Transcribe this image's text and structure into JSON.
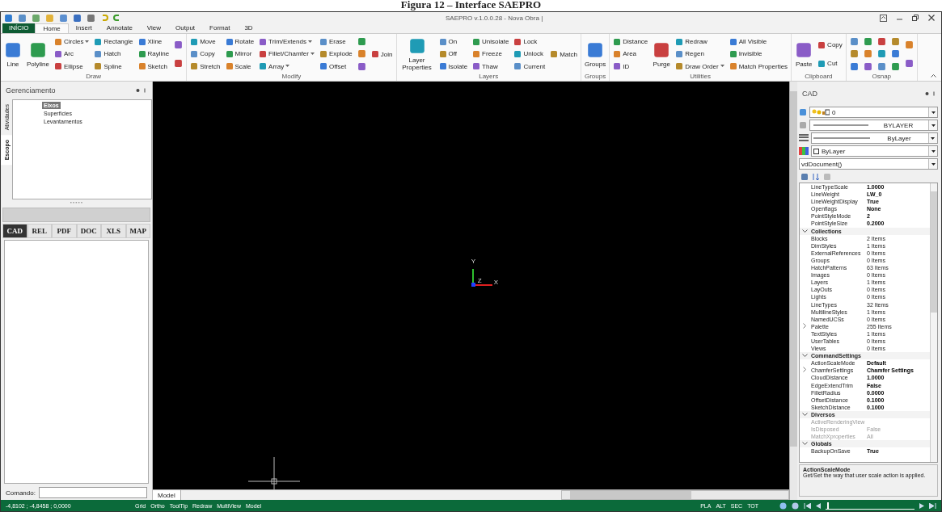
{
  "caption": "Figura 12 – Interface SAEPRO",
  "window": {
    "title": "SAEPRO v.1.0.0.28 - Nova Obra |"
  },
  "ribbon_tabs": [
    {
      "label": "INÍCIO",
      "kind": "app",
      "selected": false
    },
    {
      "label": "Home",
      "kind": "tab",
      "selected": true
    },
    {
      "label": "Insert",
      "kind": "tab",
      "selected": false
    },
    {
      "label": "Annotate",
      "kind": "tab",
      "selected": false
    },
    {
      "label": "View",
      "kind": "tab",
      "selected": false
    },
    {
      "label": "Output",
      "kind": "tab",
      "selected": false
    },
    {
      "label": "Format",
      "kind": "tab",
      "selected": false
    },
    {
      "label": "3D",
      "kind": "tab",
      "selected": false
    }
  ],
  "ribbon": {
    "groups": [
      {
        "label": "Draw",
        "columns": [
          {
            "kind": "large",
            "label": "Line"
          },
          {
            "kind": "large",
            "label": "Polyline"
          },
          {
            "kind": "small",
            "items": [
              {
                "label": "Circles",
                "dropdown": true
              },
              {
                "label": "Arc",
                "dropdown": false
              },
              {
                "label": "Ellipse",
                "dropdown": false
              }
            ]
          },
          {
            "kind": "small",
            "items": [
              {
                "label": "Rectangle",
                "dropdown": false
              },
              {
                "label": "Hatch",
                "dropdown": false
              },
              {
                "label": "Spline",
                "dropdown": false
              }
            ]
          },
          {
            "kind": "small",
            "items": [
              {
                "label": "Xline",
                "dropdown": false
              },
              {
                "label": "Rayline",
                "dropdown": false
              },
              {
                "label": "Sketch",
                "dropdown": false
              }
            ]
          },
          {
            "kind": "icon_pair"
          }
        ]
      },
      {
        "label": "Modify",
        "columns": [
          {
            "kind": "small",
            "items": [
              {
                "label": "Move",
                "dropdown": false
              },
              {
                "label": "Copy",
                "dropdown": false
              },
              {
                "label": "Stretch",
                "dropdown": false
              }
            ]
          },
          {
            "kind": "small",
            "items": [
              {
                "label": "Rotate",
                "dropdown": false
              },
              {
                "label": "Mirror",
                "dropdown": false
              },
              {
                "label": "Scale",
                "dropdown": false
              }
            ]
          },
          {
            "kind": "small",
            "items": [
              {
                "label": "Trim/Extends",
                "dropdown": true
              },
              {
                "label": "Fillet/Chamfer",
                "dropdown": true
              },
              {
                "label": "Array",
                "dropdown": true
              }
            ]
          },
          {
            "kind": "small",
            "items": [
              {
                "label": "Erase",
                "dropdown": false
              },
              {
                "label": "Explode",
                "dropdown": false
              },
              {
                "label": "Offset",
                "dropdown": false
              }
            ]
          },
          {
            "kind": "icon_triple"
          },
          {
            "kind": "small",
            "items": [
              {
                "label": "Join",
                "dropdown": false
              }
            ]
          }
        ]
      },
      {
        "label": "Layers",
        "columns": [
          {
            "kind": "large",
            "label": "Layer Properties"
          },
          {
            "kind": "small",
            "items": [
              {
                "label": "On",
                "dropdown": false
              },
              {
                "label": "Off",
                "dropdown": false
              },
              {
                "label": "Isolate",
                "dropdown": false
              }
            ]
          },
          {
            "kind": "small",
            "items": [
              {
                "label": "Unisolate",
                "dropdown": false
              },
              {
                "label": "Freeze",
                "dropdown": false
              },
              {
                "label": "Thaw",
                "dropdown": false
              }
            ]
          },
          {
            "kind": "small",
            "items": [
              {
                "label": "Lock",
                "dropdown": false
              },
              {
                "label": "Unlock",
                "dropdown": false
              },
              {
                "label": "Current",
                "dropdown": false
              }
            ]
          },
          {
            "kind": "small",
            "items": [
              {
                "label": "Match",
                "dropdown": false
              }
            ]
          }
        ]
      },
      {
        "label": "Groups",
        "columns": [
          {
            "kind": "large",
            "label": "Groups"
          }
        ]
      },
      {
        "label": "Utilities",
        "columns": [
          {
            "kind": "small",
            "items": [
              {
                "label": "Distance",
                "dropdown": false
              },
              {
                "label": "Area",
                "dropdown": false
              },
              {
                "label": "ID",
                "dropdown": false
              }
            ]
          },
          {
            "kind": "large",
            "label": "Purge"
          },
          {
            "kind": "small",
            "items": [
              {
                "label": "Redraw",
                "dropdown": false
              },
              {
                "label": "Regen",
                "dropdown": false
              },
              {
                "label": "Draw Order",
                "dropdown": true
              }
            ]
          },
          {
            "kind": "small",
            "items": [
              {
                "label": "All Visible",
                "dropdown": false
              },
              {
                "label": "Invisible",
                "dropdown": false
              },
              {
                "label": "Match Properties",
                "dropdown": false
              }
            ]
          }
        ]
      },
      {
        "label": "Clipboard",
        "columns": [
          {
            "kind": "large",
            "label": "Paste"
          },
          {
            "kind": "small",
            "items": [
              {
                "label": "Copy",
                "dropdown": false
              },
              {
                "label": "Cut",
                "dropdown": false
              }
            ]
          }
        ]
      },
      {
        "label": "Osnap",
        "columns": [
          {
            "kind": "icon_triple"
          },
          {
            "kind": "icon_triple"
          },
          {
            "kind": "icon_triple"
          },
          {
            "kind": "icon_triple"
          },
          {
            "kind": "icon_pair"
          }
        ]
      }
    ]
  },
  "left_panel": {
    "title": "Gerenciamento",
    "side_tabs": [
      {
        "label": "Atividades",
        "selected": false
      },
      {
        "label": "Escopo",
        "selected": true
      }
    ],
    "tree": [
      {
        "label": "Eixos",
        "selected": true
      },
      {
        "label": "Superfícies",
        "selected": false
      },
      {
        "label": "Levantamentos",
        "selected": false
      }
    ],
    "doc_tabs": [
      {
        "label": "CAD",
        "selected": true
      },
      {
        "label": "REL",
        "selected": false
      },
      {
        "label": "PDF",
        "selected": false
      },
      {
        "label": "DOC",
        "selected": false
      },
      {
        "label": "XLS",
        "selected": false
      },
      {
        "label": "MAP",
        "selected": false
      }
    ],
    "command": {
      "label": "Comando:"
    }
  },
  "canvas": {
    "axes": {
      "y": "Y",
      "z": "Z",
      "x": "X"
    },
    "layout_tabs": [
      {
        "label": "Model",
        "selected": true
      }
    ]
  },
  "right_panel": {
    "title": "CAD",
    "layer": "0",
    "linetype": "BYLAYER",
    "lineweight": "ByLayer",
    "color_setting": "ByLayer",
    "object": "vdDocument()",
    "properties": [
      {
        "kind": "property",
        "name": "LineTypeScale",
        "value": "1.0000",
        "modified": true,
        "disabled": false,
        "expandable": false
      },
      {
        "kind": "property",
        "name": "LineWeight",
        "value": "LW_0",
        "modified": true,
        "disabled": false,
        "expandable": false
      },
      {
        "kind": "property",
        "name": "LineWeightDisplay",
        "value": "True",
        "modified": true,
        "disabled": false,
        "expandable": false
      },
      {
        "kind": "property",
        "name": "Openflags",
        "value": "None",
        "modified": true,
        "disabled": false,
        "expandable": false
      },
      {
        "kind": "property",
        "name": "PointStyleMode",
        "value": "2",
        "modified": true,
        "disabled": false,
        "expandable": false
      },
      {
        "kind": "property",
        "name": "PointStyleSize",
        "value": "0.2000",
        "modified": true,
        "disabled": false,
        "expandable": false
      },
      {
        "kind": "category",
        "name": "Collections",
        "expanded": true
      },
      {
        "kind": "property",
        "name": "Blocks",
        "value": "2 Items",
        "modified": false,
        "disabled": false,
        "expandable": false
      },
      {
        "kind": "property",
        "name": "DimStyles",
        "value": "1 Items",
        "modified": false,
        "disabled": false,
        "expandable": false
      },
      {
        "kind": "property",
        "name": "ExternalReferences",
        "value": "0 Items",
        "modified": false,
        "disabled": false,
        "expandable": false
      },
      {
        "kind": "property",
        "name": "Groups",
        "value": "0 Items",
        "modified": false,
        "disabled": false,
        "expandable": false
      },
      {
        "kind": "property",
        "name": "HatchPatterns",
        "value": "63 Items",
        "modified": false,
        "disabled": false,
        "expandable": false
      },
      {
        "kind": "property",
        "name": "Images",
        "value": "0 Items",
        "modified": false,
        "disabled": false,
        "expandable": false
      },
      {
        "kind": "property",
        "name": "Layers",
        "value": "1 Items",
        "modified": false,
        "disabled": false,
        "expandable": false
      },
      {
        "kind": "property",
        "name": "LayOuts",
        "value": "0 Items",
        "modified": false,
        "disabled": false,
        "expandable": false
      },
      {
        "kind": "property",
        "name": "Lights",
        "value": "0 Items",
        "modified": false,
        "disabled": false,
        "expandable": false
      },
      {
        "kind": "property",
        "name": "LineTypes",
        "value": "32 Items",
        "modified": false,
        "disabled": false,
        "expandable": false
      },
      {
        "kind": "property",
        "name": "MultilineStyles",
        "value": "1 Items",
        "modified": false,
        "disabled": false,
        "expandable": false
      },
      {
        "kind": "property",
        "name": "NamedUCSs",
        "value": "0 Items",
        "modified": false,
        "disabled": false,
        "expandable": false
      },
      {
        "kind": "property",
        "name": "Palette",
        "value": "255 Items",
        "modified": false,
        "disabled": false,
        "expandable": true
      },
      {
        "kind": "property",
        "name": "TextStyles",
        "value": "1 Items",
        "modified": false,
        "disabled": false,
        "expandable": false
      },
      {
        "kind": "property",
        "name": "UserTables",
        "value": "0 Items",
        "modified": false,
        "disabled": false,
        "expandable": false
      },
      {
        "kind": "property",
        "name": "Views",
        "value": "0 Items",
        "modified": false,
        "disabled": false,
        "expandable": false
      },
      {
        "kind": "category",
        "name": "CommandSettings",
        "expanded": true
      },
      {
        "kind": "property",
        "name": "ActionScaleMode",
        "value": "Default",
        "modified": true,
        "disabled": false,
        "expandable": false
      },
      {
        "kind": "property",
        "name": "ChamferSettings",
        "value": "Chamfer Settings",
        "modified": true,
        "disabled": false,
        "expandable": true
      },
      {
        "kind": "property",
        "name": "CloudDistance",
        "value": "1.0000",
        "modified": true,
        "disabled": false,
        "expandable": false
      },
      {
        "kind": "property",
        "name": "EdgeExtendTrim",
        "value": "False",
        "modified": true,
        "disabled": false,
        "expandable": false
      },
      {
        "kind": "property",
        "name": "FilletRadius",
        "value": "0.0000",
        "modified": true,
        "disabled": false,
        "expandable": false
      },
      {
        "kind": "property",
        "name": "OffsetDistance",
        "value": "0.1000",
        "modified": true,
        "disabled": false,
        "expandable": false
      },
      {
        "kind": "property",
        "name": "SketchDistance",
        "value": "0.1000",
        "modified": true,
        "disabled": false,
        "expandable": false
      },
      {
        "kind": "category",
        "name": "Diversos",
        "expanded": true
      },
      {
        "kind": "property",
        "name": "ActiveRenderingView",
        "disabled": true,
        "expandable": false
      },
      {
        "kind": "property",
        "name": "IsDisposed",
        "value": "False",
        "modified": false,
        "disabled": true,
        "expandable": false
      },
      {
        "kind": "property",
        "name": "MatchXproperties",
        "value": "All",
        "modified": false,
        "disabled": true,
        "expandable": false
      },
      {
        "kind": "category",
        "name": "Globals",
        "expanded": true
      },
      {
        "kind": "property",
        "name": "BackupOnSave",
        "value": "True",
        "modified": true,
        "disabled": false,
        "expandable": false
      }
    ],
    "description": {
      "title": "ActionScaleMode",
      "text": "Get/Set the way that user scale action is applied."
    }
  },
  "status_bar": {
    "coordinates": "-4,8102 ; -4,8458 ; 0,0000",
    "toggles": [
      "Grid",
      "Ortho",
      "ToolTip",
      "Redraw",
      "MultiView",
      "Model"
    ],
    "modes": [
      "PLA",
      "ALT",
      "SEC",
      "TOT"
    ],
    "timeline": {
      "level": 0.02
    }
  }
}
